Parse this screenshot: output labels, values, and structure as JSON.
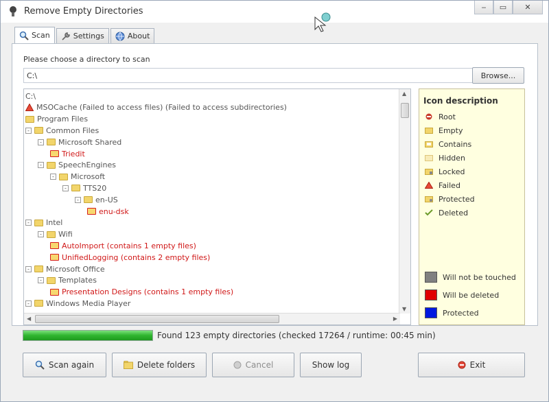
{
  "window": {
    "title": "Remove Empty Directories",
    "controls": [
      "‒",
      "▭",
      "✕"
    ]
  },
  "tabs": [
    {
      "label": "Scan",
      "icon": "magnifier-icon",
      "active": true
    },
    {
      "label": "Settings",
      "icon": "wrench-icon",
      "active": false
    },
    {
      "label": "About",
      "icon": "globe-icon",
      "active": false
    }
  ],
  "scan": {
    "prompt": "Please choose a directory to scan",
    "directory": "C:\\",
    "browse_label": "Browse..."
  },
  "tree": {
    "rows": [
      {
        "label": "C:\\",
        "level": 0,
        "kind": "root",
        "color": "gray"
      },
      {
        "label": "MSOCache (Failed to access files) (Failed to access subdirectories)",
        "level": 0,
        "kind": "failed",
        "color": "gray"
      },
      {
        "label": "Program Files",
        "level": 0,
        "kind": "folder",
        "color": "gray"
      },
      {
        "label": "Common Files",
        "level": 0,
        "kind": "folder",
        "color": "gray",
        "expander": "-"
      },
      {
        "label": "Microsoft Shared",
        "level": 1,
        "kind": "folder",
        "color": "gray",
        "expander": "-"
      },
      {
        "label": "Triedit",
        "level": 2,
        "kind": "folder",
        "color": "red"
      },
      {
        "label": "SpeechEngines",
        "level": 1,
        "kind": "folder",
        "color": "gray",
        "expander": "-"
      },
      {
        "label": "Microsoft",
        "level": 2,
        "kind": "folder",
        "color": "gray",
        "expander": "-"
      },
      {
        "label": "TTS20",
        "level": 3,
        "kind": "folder",
        "color": "gray",
        "expander": "-"
      },
      {
        "label": "en-US",
        "level": 4,
        "kind": "folder",
        "color": "gray",
        "expander": "-"
      },
      {
        "label": "enu-dsk",
        "level": 5,
        "kind": "folder",
        "color": "red"
      },
      {
        "label": "Intel",
        "level": 0,
        "kind": "folder",
        "color": "gray",
        "expander": "-"
      },
      {
        "label": "Wifi",
        "level": 1,
        "kind": "folder",
        "color": "gray",
        "expander": "-"
      },
      {
        "label": "AutoImport (contains 1 empty files)",
        "level": 2,
        "kind": "folder",
        "color": "red"
      },
      {
        "label": "UnifiedLogging (contains 2 empty files)",
        "level": 2,
        "kind": "folder",
        "color": "red"
      },
      {
        "label": "Microsoft Office",
        "level": 0,
        "kind": "folder",
        "color": "gray",
        "expander": "-"
      },
      {
        "label": "Templates",
        "level": 1,
        "kind": "folder",
        "color": "gray",
        "expander": "-"
      },
      {
        "label": "Presentation Designs (contains 1 empty files)",
        "level": 2,
        "kind": "folder",
        "color": "red"
      },
      {
        "label": "Windows Media Player",
        "level": 0,
        "kind": "folder",
        "color": "gray",
        "expander": "-"
      }
    ]
  },
  "legend": {
    "title": "Icon description",
    "icons": [
      {
        "label": "Root",
        "icon": "root-icon"
      },
      {
        "label": "Empty",
        "icon": "empty-folder-icon"
      },
      {
        "label": "Contains",
        "icon": "contains-folder-icon"
      },
      {
        "label": "Hidden",
        "icon": "hidden-folder-icon"
      },
      {
        "label": "Locked",
        "icon": "locked-folder-icon"
      },
      {
        "label": "Failed",
        "icon": "failed-icon"
      },
      {
        "label": "Protected",
        "icon": "protected-folder-icon"
      },
      {
        "label": "Deleted",
        "icon": "deleted-icon"
      }
    ],
    "colors": [
      {
        "label": "Will not be touched",
        "color": "#808080"
      },
      {
        "label": "Will be deleted",
        "color": "#e00000"
      },
      {
        "label": "Protected",
        "color": "#0018e0"
      }
    ]
  },
  "progress": {
    "fraction": 1.0,
    "status": "Found 123 empty directories (checked 17264 / runtime: 00:45 min)"
  },
  "buttons": {
    "scan_again": "Scan again",
    "delete_folders": "Delete folders",
    "cancel": "Cancel",
    "show_log": "Show log",
    "exit": "Exit"
  }
}
